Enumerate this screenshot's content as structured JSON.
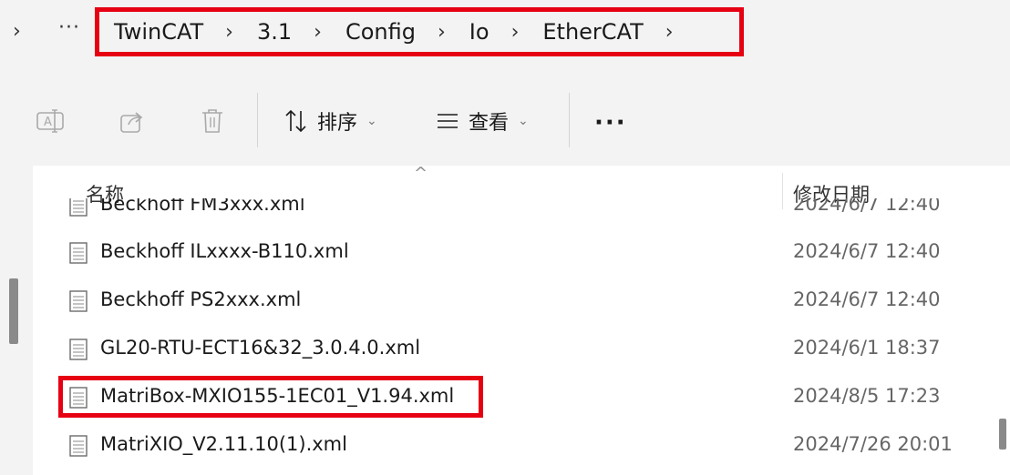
{
  "address": {
    "expand_glyph": "›",
    "more_glyph": "···",
    "breadcrumbs": [
      {
        "label": "TwinCAT"
      },
      {
        "label": "3.1"
      },
      {
        "label": "Config"
      },
      {
        "label": "Io"
      },
      {
        "label": "EtherCAT"
      }
    ],
    "separator": "›",
    "highlight_color": "#e60012"
  },
  "toolbar": {
    "rename_icon": "rename-icon",
    "share_icon": "share-icon",
    "delete_icon": "delete-icon",
    "sort_label": "排序",
    "sort_icon": "sort-arrows-icon",
    "view_label": "查看",
    "view_icon": "view-lines-icon",
    "caret": "⌄",
    "more_label": "···"
  },
  "filelist": {
    "sort_indicator": "^",
    "columns": {
      "name": "名称",
      "modified": "修改日期"
    },
    "files": [
      {
        "name": "Beckhoff FM3xxx.xml",
        "date": "2024/6/7 12:40"
      },
      {
        "name": "Beckhoff ILxxxx-B110.xml",
        "date": "2024/6/7 12:40"
      },
      {
        "name": "Beckhoff PS2xxx.xml",
        "date": "2024/6/7 12:40"
      },
      {
        "name": "GL20-RTU-ECT16&32_3.0.4.0.xml",
        "date": "2024/6/1 18:37"
      },
      {
        "name": "MatriBox-MXIO155-1EC01_V1.94.xml",
        "date": "2024/8/5 17:23",
        "highlighted": true
      },
      {
        "name": "MatriXIO_V2.11.10(1).xml",
        "date": "2024/7/26 20:01"
      }
    ]
  }
}
